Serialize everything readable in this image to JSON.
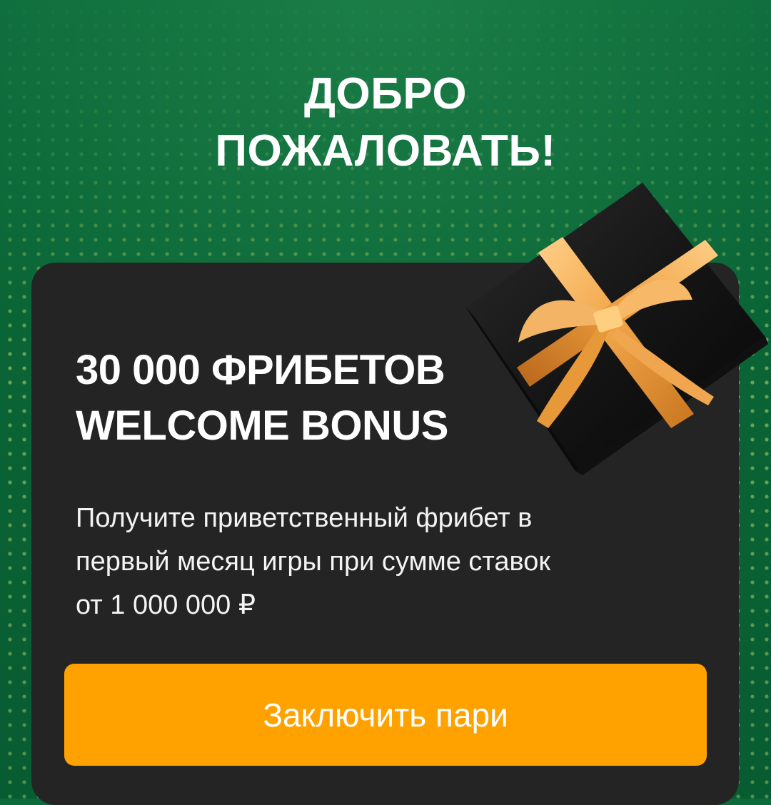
{
  "hero": {
    "title_line1": "ДОБРО",
    "title_line2": "ПОЖАЛОВАТЬ!"
  },
  "promo": {
    "title_line1": "30 000 ФРИБЕТОВ",
    "title_line2": "WELCOME BONUS",
    "description_line1": "Получите приветственный фрибет в",
    "description_line2": "первый месяц игры при сумме ставок",
    "description_line3": "от 1 000 000 ₽",
    "cta_label": "Заключить пари",
    "gift_icon": "gift-box-icon"
  },
  "colors": {
    "background": "#0b6b3a",
    "card": "#242424",
    "button": "#ffa200",
    "ribbon": "#f2a64a"
  }
}
